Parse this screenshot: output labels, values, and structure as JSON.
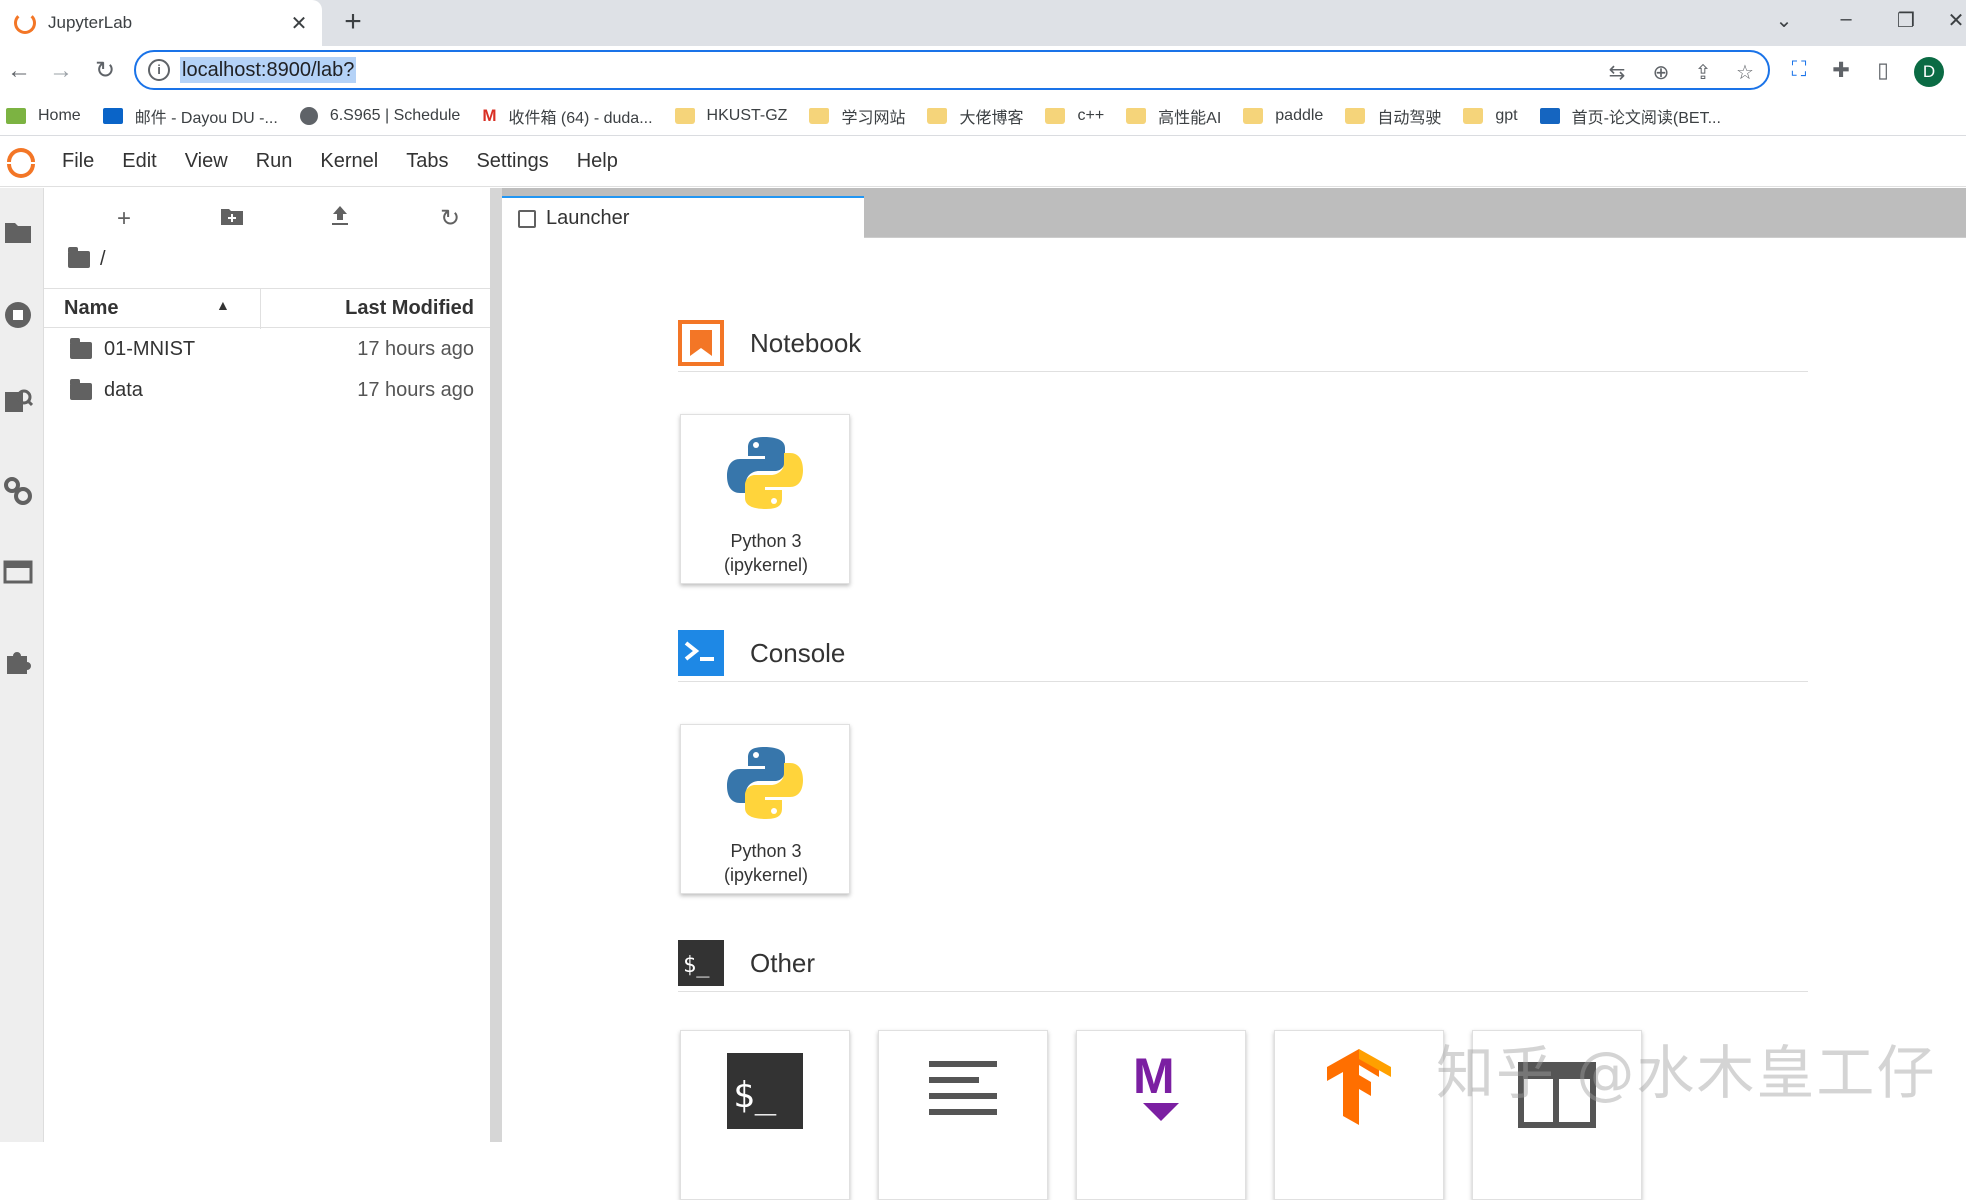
{
  "browser": {
    "tab_title": "JupyterLab",
    "tab_close": "✕",
    "new_tab": "+",
    "url": "localhost:8900/lab?",
    "profile_initial": "D",
    "bookmarks": [
      {
        "label": "Home"
      },
      {
        "label": "邮件 - Dayou DU -..."
      },
      {
        "label": "6.S965 | Schedule"
      },
      {
        "label": "收件箱 (64) - duda..."
      },
      {
        "label": "HKUST-GZ"
      },
      {
        "label": "学习网站"
      },
      {
        "label": "大佬博客"
      },
      {
        "label": "c++"
      },
      {
        "label": "高性能AI"
      },
      {
        "label": "paddle"
      },
      {
        "label": "自动驾驶"
      },
      {
        "label": "gpt"
      },
      {
        "label": "首页-论文阅读(BET..."
      }
    ]
  },
  "menubar": {
    "items": [
      "File",
      "Edit",
      "View",
      "Run",
      "Kernel",
      "Tabs",
      "Settings",
      "Help"
    ]
  },
  "filebrowser": {
    "path": "/",
    "col_name": "Name",
    "col_modified": "Last Modified",
    "rows": [
      {
        "name": "01-MNIST",
        "modified": "17 hours ago"
      },
      {
        "name": "data",
        "modified": "17 hours ago"
      }
    ]
  },
  "launcher": {
    "tab_label": "Launcher",
    "sections": [
      {
        "title": "Notebook",
        "cards": [
          {
            "label_line1": "Python 3",
            "label_line2": "(ipykernel)"
          }
        ]
      },
      {
        "title": "Console",
        "cards": [
          {
            "label_line1": "Python 3",
            "label_line2": "(ipykernel)"
          }
        ]
      },
      {
        "title": "Other"
      }
    ]
  },
  "watermark": "知乎 @水木皇工仔",
  "colors": {
    "accent": "#1a73e8",
    "jupyter_orange": "#f37626",
    "active_tab": "#2196f3"
  }
}
